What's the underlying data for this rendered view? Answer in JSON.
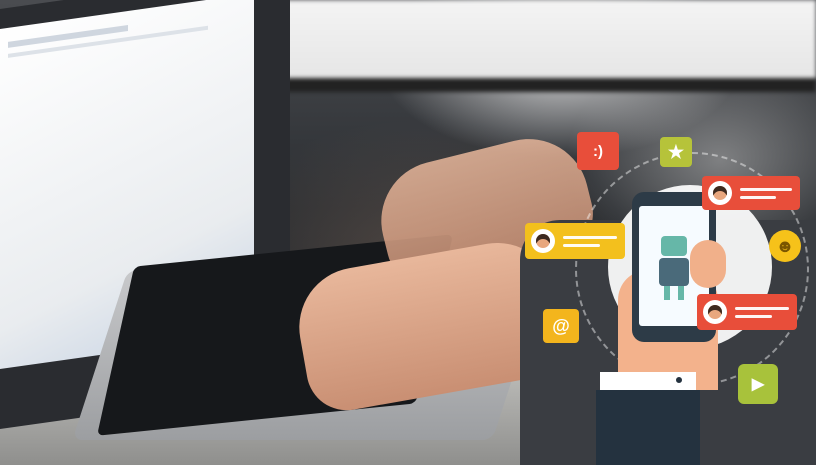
{
  "scene": {
    "description_labels": {},
    "colors": {
      "red_bubble": "#e84e3a",
      "yellow_bubble": "#f3c01d",
      "green_bubble": "#a8c23b",
      "phone": "#2d3b47",
      "sleeve": "#24323f"
    }
  },
  "overlay": {
    "smiley_text": ":)",
    "star_glyph": "★",
    "at_glyph": "@",
    "play_glyph": "▶",
    "emoji_glyph": "☻"
  }
}
